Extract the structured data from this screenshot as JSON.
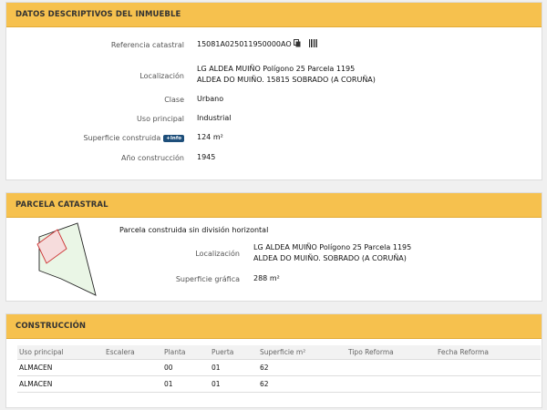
{
  "datos": {
    "title": "DATOS DESCRIPTIVOS DEL INMUEBLE",
    "referencia_label": "Referencia catastral",
    "referencia_value": "15081A025011950000AO",
    "localizacion_label": "Localización",
    "localizacion_line1": "LG ALDEA MUIÑO Polígono 25 Parcela 1195",
    "localizacion_line2": "ALDEA DO MUIÑO. 15815 SOBRADO (A CORUÑA)",
    "clase_label": "Clase",
    "clase_value": "Urbano",
    "uso_label": "Uso principal",
    "uso_value": "Industrial",
    "superficie_label": "Superficie construida",
    "info_badge": "+Info",
    "superficie_value": "124 m²",
    "anio_label": "Año construcción",
    "anio_value": "1945"
  },
  "parcela": {
    "title": "PARCELA CATASTRAL",
    "descripcion": "Parcela construida sin división horizontal",
    "localizacion_label": "Localización",
    "localizacion_line1": "LG ALDEA MUIÑO Polígono 25 Parcela 1195",
    "localizacion_line2": "ALDEA DO MUIÑO. SOBRADO (A CORUÑA)",
    "superficie_label": "Superficie gráfica",
    "superficie_value": "288 m²"
  },
  "construccion": {
    "title": "CONSTRUCCIÓN",
    "columns": [
      "Uso principal",
      "Escalera",
      "Planta",
      "Puerta",
      "Superficie m²",
      "Tipo Reforma",
      "Fecha Reforma"
    ],
    "rows": [
      [
        "ALMACEN",
        "",
        "00",
        "01",
        "62",
        "",
        ""
      ],
      [
        "ALMACEN",
        "",
        "01",
        "01",
        "62",
        "",
        ""
      ]
    ]
  },
  "icons": [
    "copy-icon",
    "barcode-icon"
  ],
  "colors": {
    "header": "#f6c14e",
    "badge": "#1d4e7a",
    "parcel_fill": "#eaf6e6",
    "building_fill": "#f6dcdc"
  }
}
